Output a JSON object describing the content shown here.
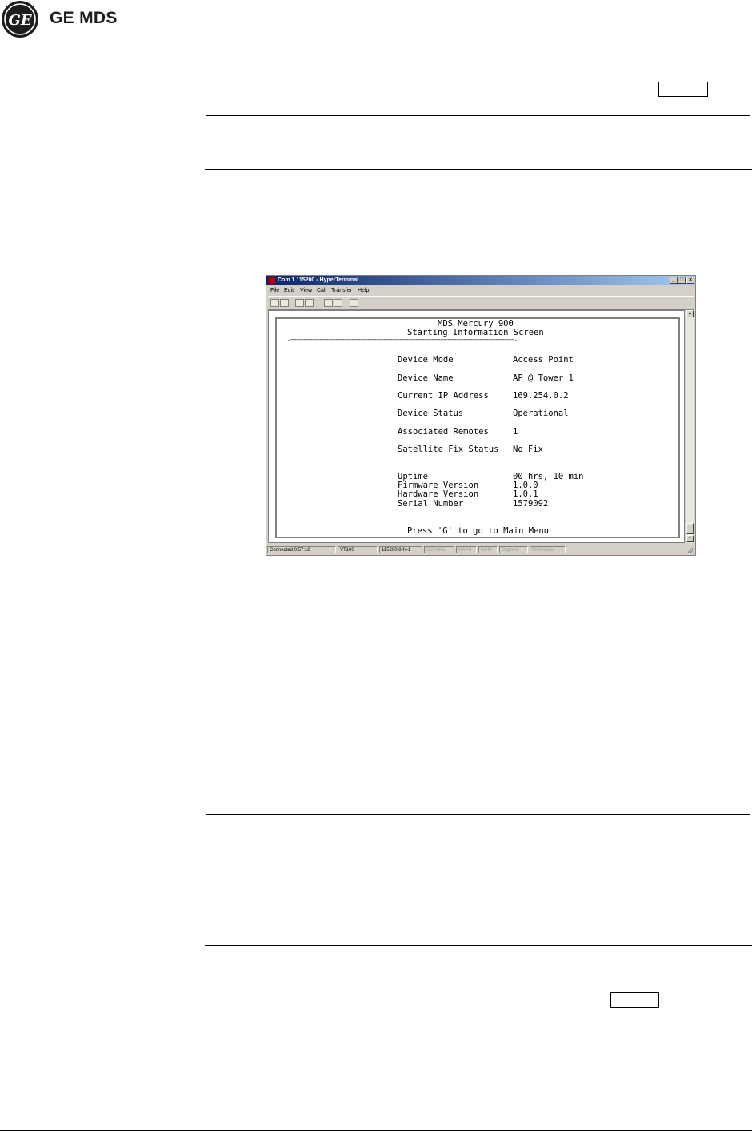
{
  "header": {
    "brand": "GE MDS",
    "logo_text": "GE"
  },
  "window": {
    "title": "Com 1 115200 - HyperTerminal",
    "menu": [
      "File",
      "Edit",
      "View",
      "Call",
      "Transfer",
      "Help"
    ],
    "controls": {
      "minimize": "_",
      "maximize": "□",
      "close": "×"
    }
  },
  "terminal": {
    "title1": "MDS Mercury 900",
    "title2": "Starting Information Screen",
    "separator": "-======================================================================-",
    "rows": [
      {
        "label": "Device Mode",
        "value": "Access Point"
      },
      {
        "label": "Device Name",
        "value": "AP @ Tower 1"
      },
      {
        "label": "Current IP Address",
        "value": "169.254.0.2"
      },
      {
        "label": "Device Status",
        "value": "Operational"
      },
      {
        "label": "Associated Remotes",
        "value": "1"
      },
      {
        "label": "Satellite Fix Status",
        "value": "No Fix"
      }
    ],
    "info": [
      {
        "label": "Uptime",
        "value": "00 hrs, 10 min"
      },
      {
        "label": "Firmware Version",
        "value": "1.0.0"
      },
      {
        "label": "Hardware Version",
        "value": "1.0.1"
      },
      {
        "label": "Serial Number",
        "value": "1579092"
      }
    ],
    "footer": "Press 'G' to go to Main Menu"
  },
  "statusbar": [
    "Connected 0:57:18",
    "VT100",
    "115200 8-N-1",
    "SCROLL",
    "CAPS",
    "NUM",
    "Capture",
    "Print echo"
  ]
}
